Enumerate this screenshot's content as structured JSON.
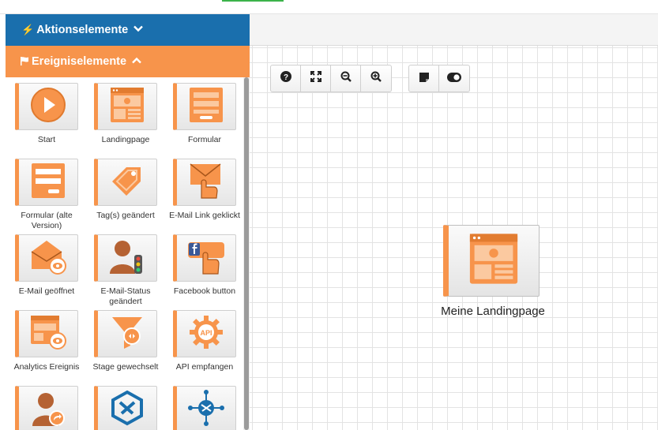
{
  "sidebar": {
    "aktion_header": {
      "label": "Aktionselemente",
      "icon": "bolt-icon"
    },
    "ereignis_header": {
      "label": "Ereigniselemente",
      "icon": "flag-icon"
    },
    "tiles": [
      {
        "label": "Start",
        "icon": "play-icon"
      },
      {
        "label": "Landingpage",
        "icon": "landingpage-icon"
      },
      {
        "label": "Formular",
        "icon": "form-icon"
      },
      {
        "label": "Formular (alte Version)",
        "icon": "old-form-icon"
      },
      {
        "label": "Tag(s) geändert",
        "icon": "tag-icon"
      },
      {
        "label": "E-Mail Link geklickt",
        "icon": "email-click-icon"
      },
      {
        "label": "E-Mail geöffnet",
        "icon": "email-opened-icon"
      },
      {
        "label": "E-Mail-Status geändert",
        "icon": "email-status-icon"
      },
      {
        "label": "Facebook button",
        "icon": "facebook-button-icon"
      },
      {
        "label": "Analytics Ereignis",
        "icon": "analytics-icon"
      },
      {
        "label": "Stage gewechselt",
        "icon": "stage-funnel-icon"
      },
      {
        "label": "API empfangen",
        "icon": "api-gear-icon"
      },
      {
        "label": "",
        "icon": "user-share-icon"
      },
      {
        "label": "",
        "icon": "brand-s-icon"
      },
      {
        "label": "",
        "icon": "network-hub-icon"
      }
    ]
  },
  "toolbar": {
    "group1": [
      "help-icon",
      "fit-screen-icon",
      "zoom-out-icon",
      "zoom-in-icon"
    ],
    "group2": [
      "sticky-note-icon",
      "toggle-icon"
    ]
  },
  "canvas": {
    "node": {
      "label": "Meine Landingpage",
      "icon": "landingpage-icon"
    }
  },
  "colors": {
    "blue": "#1a6fad",
    "orange": "#f7944b",
    "green": "#3cb34a"
  }
}
